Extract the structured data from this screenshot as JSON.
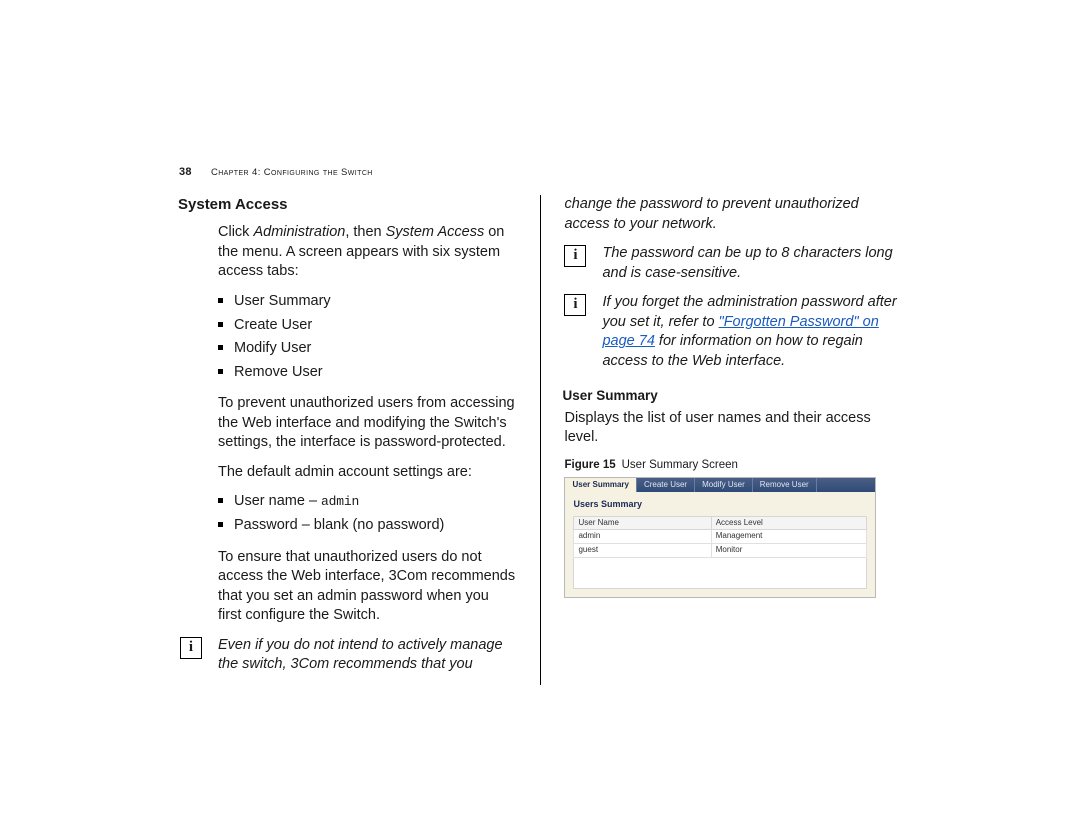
{
  "header": {
    "page_number": "38",
    "chapter_label": "Chapter 4: Configuring the Switch"
  },
  "left_col": {
    "section_title": "System Access",
    "intro_a": "Click ",
    "intro_em1": "Administration",
    "intro_b": ", then ",
    "intro_em2": "System Access",
    "intro_c": " on the menu. A screen appears with six system access tabs:",
    "tabs": [
      "User Summary",
      "Create User",
      "Modify User",
      "Remove User"
    ],
    "prevent": "To prevent unauthorized users from accessing the Web interface and modifying the Switch's settings, the interface is password-protected.",
    "defaults_lead": "The default admin account settings are:",
    "def_user_label": "User name – ",
    "def_user_value": "admin",
    "def_pw": "Password – blank (no password)",
    "ensure": "To ensure that unauthorized users do not access the Web interface, 3Com recommends that you set an admin password when you first configure the Switch.",
    "note1": "Even if you do not intend to actively manage the switch, 3Com recommends that you"
  },
  "right_col": {
    "cont": "change the password to prevent unauthorized access to your network.",
    "note2": "The password can be up to 8 characters long and is case-sensitive.",
    "note3_a": "If you forget the administration password after you set it, refer to ",
    "note3_link1": "\"Forgotten Password\" on page 74",
    "note3_b": " for information on how to regain access to the Web interface.",
    "sub_title": "User Summary",
    "sub_body": "Displays the list of user names and their access level.",
    "fig_label": "Figure 15",
    "fig_caption": "User Summary Screen",
    "fig": {
      "tabs": [
        "User Summary",
        "Create User",
        "Modify User",
        "Remove User"
      ],
      "panel_title": "Users Summary",
      "col1": "User Name",
      "col2": "Access Level",
      "rows": [
        {
          "u": "admin",
          "a": "Management"
        },
        {
          "u": "guest",
          "a": "Monitor"
        }
      ]
    }
  }
}
